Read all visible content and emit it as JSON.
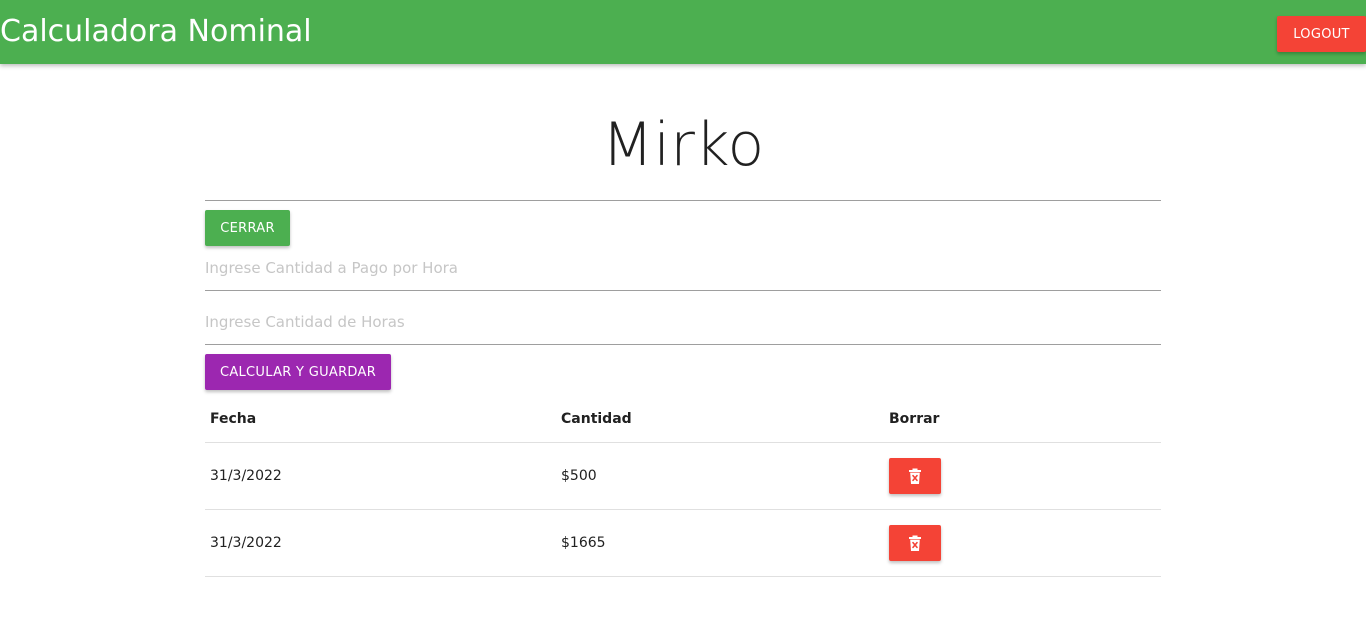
{
  "navbar": {
    "brand": "Calculadora Nominal",
    "logout_label": "LOGOUT"
  },
  "main": {
    "title": "Mirko",
    "close_label": "CERRAR",
    "rate_placeholder": "Ingrese Cantidad a Pago por Hora",
    "hours_placeholder": "Ingrese Cantidad de Horas",
    "calculate_label": "CALCULAR Y GUARDAR"
  },
  "table": {
    "headers": [
      "Fecha",
      "Cantidad",
      "Borrar"
    ],
    "rows": [
      {
        "date": "31/3/2022",
        "amount": "$500",
        "delete_icon": "trash-icon"
      },
      {
        "date": "31/3/2022",
        "amount": "$1665",
        "delete_icon": "trash-icon"
      }
    ]
  },
  "colors": {
    "navbar": "#4caf50",
    "logout": "#f44336",
    "close_button": "#4caf50",
    "calculate_button": "#9c27b0",
    "delete_button": "#f44336"
  }
}
